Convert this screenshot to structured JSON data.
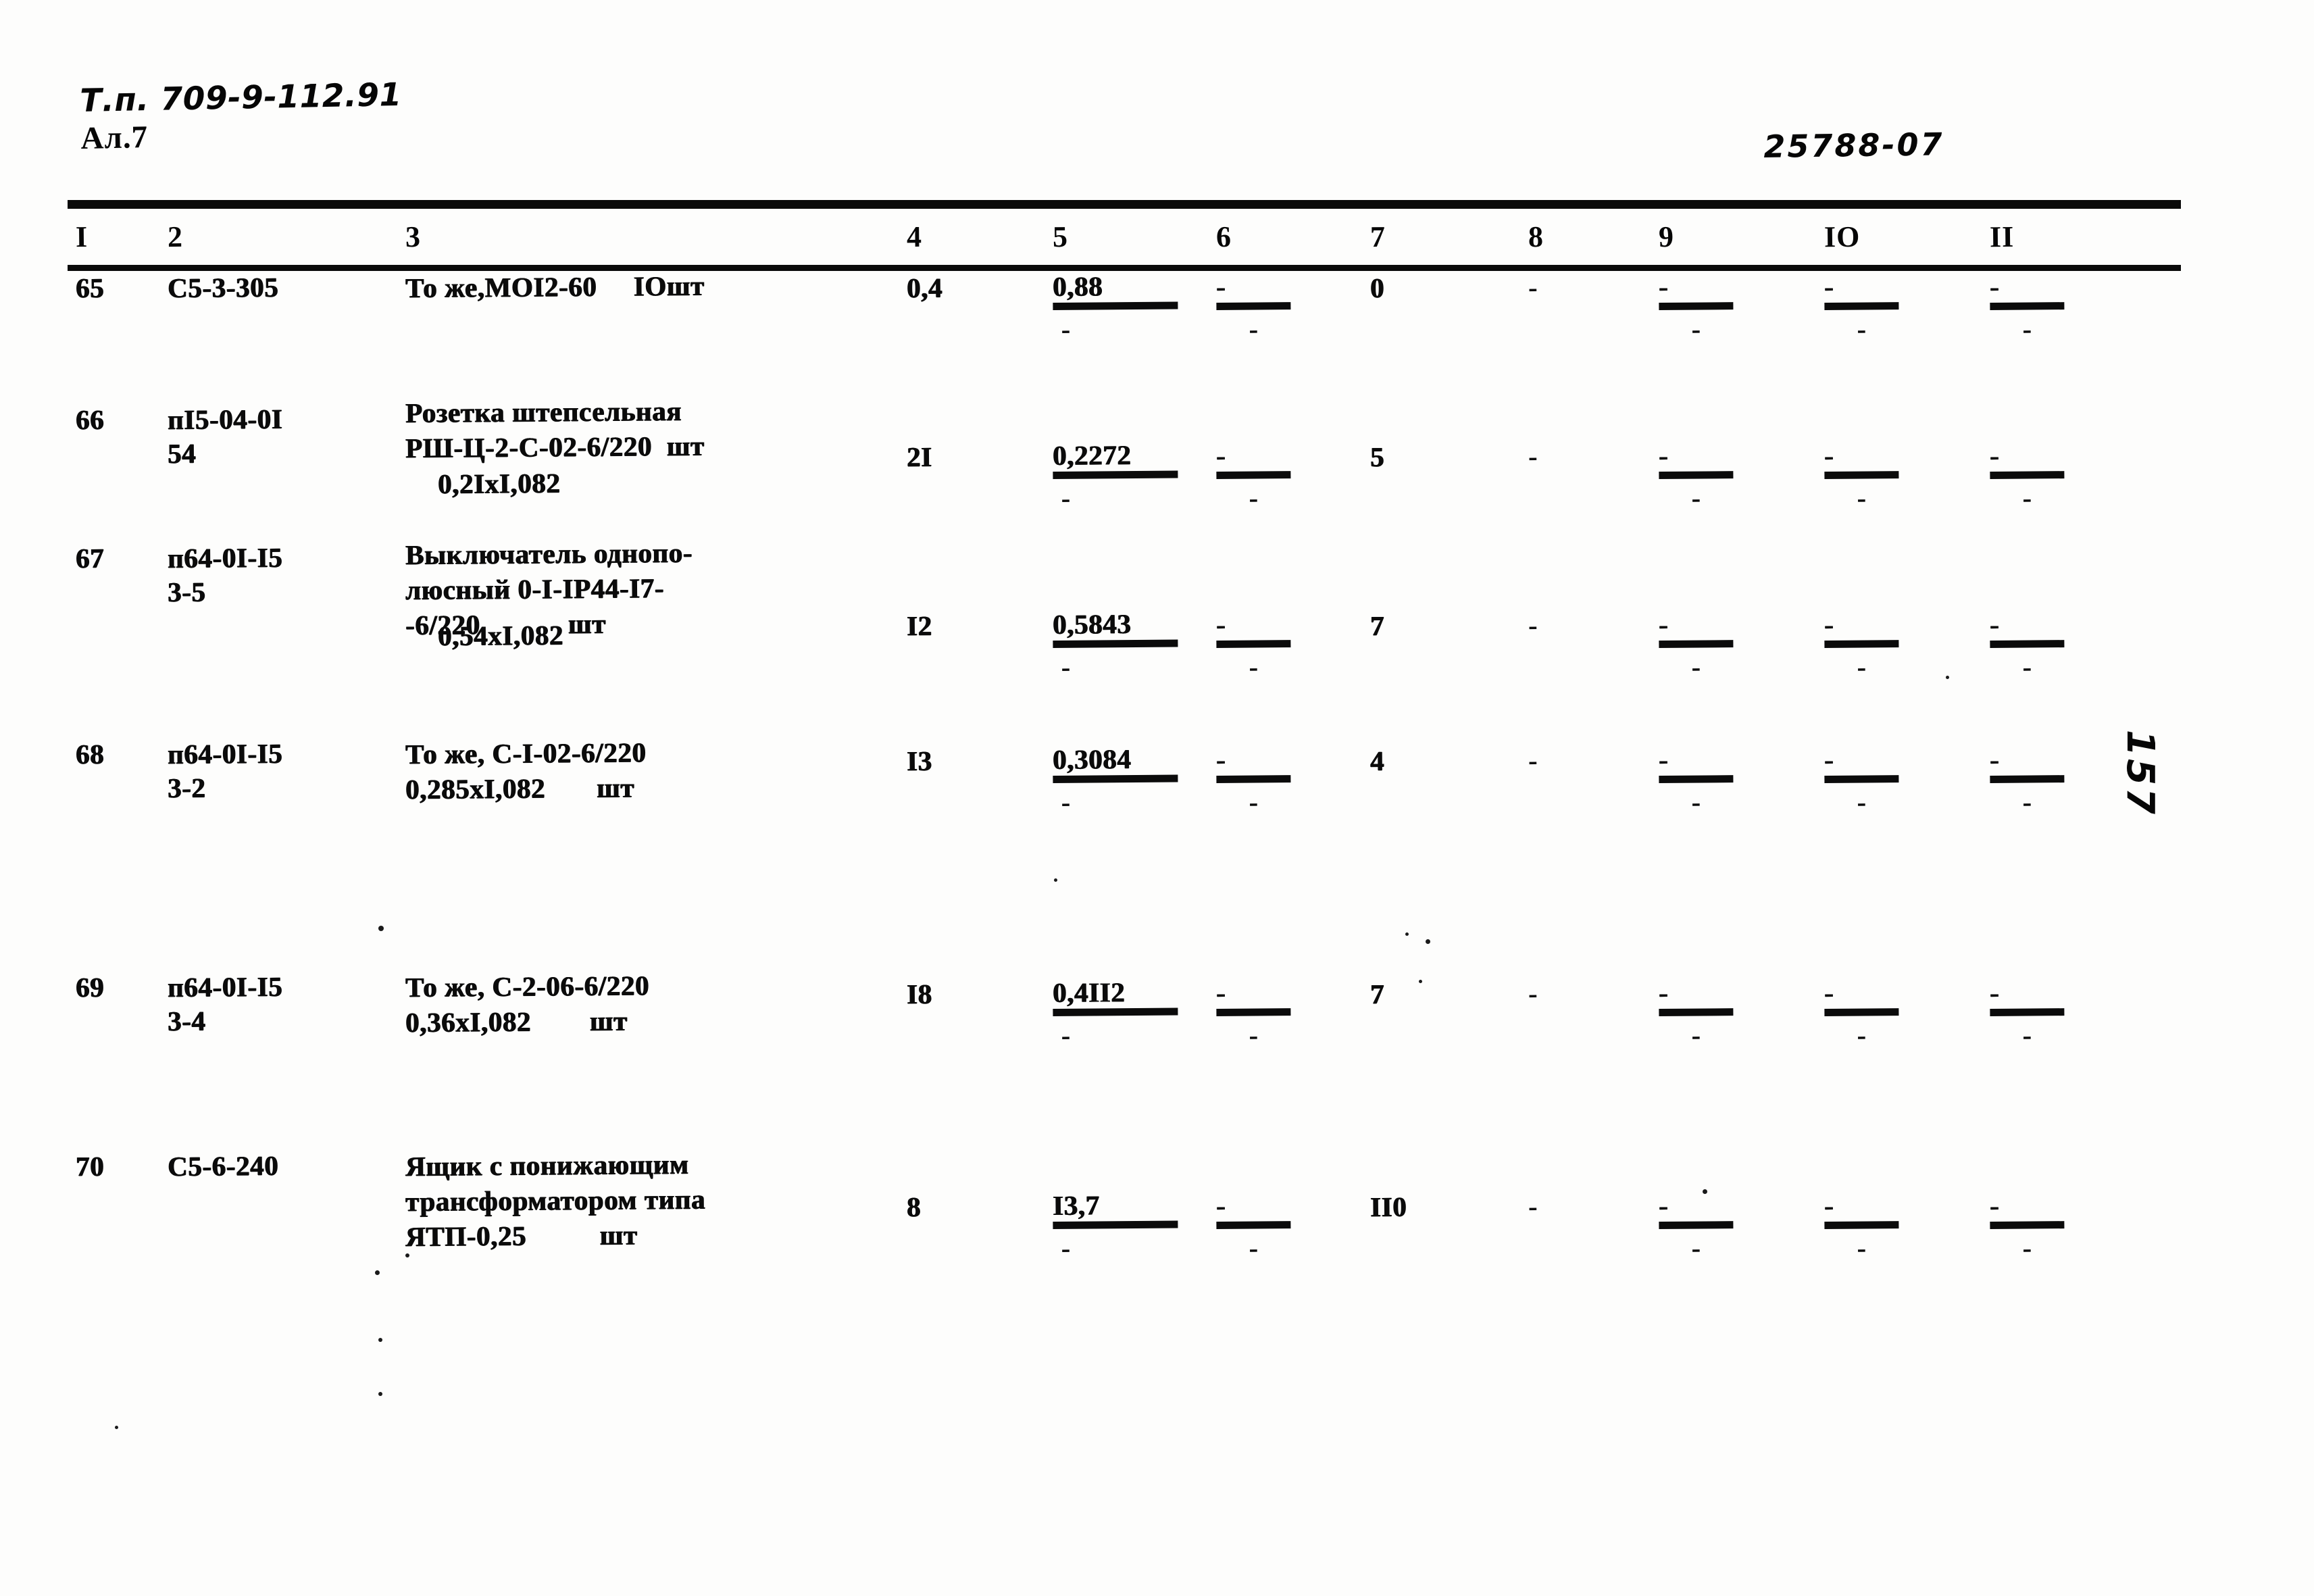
{
  "header": {
    "doc_code": "Т.п. 709-9-112.91",
    "album": "Ал.7",
    "album_ref": "25788-07"
  },
  "page_number": "157",
  "table": {
    "column_headers": [
      "I",
      "2",
      "3",
      "4",
      "5",
      "6",
      "7",
      "8",
      "9",
      "IO",
      "II"
    ],
    "rows": [
      {
        "num": "65",
        "code": "С5-3-305",
        "desc_line1": "То же,МОI2-60     IOшт",
        "desc_line2": "",
        "desc_line3": "",
        "sub_line": "",
        "col4": "0,4",
        "col5_top": "0,88",
        "col5_bot": "-",
        "col6_top": "-",
        "col6_bot": "-",
        "col7": "0",
        "col8": "-",
        "col9_top": "-",
        "col9_bot": "-",
        "col10_top": "-",
        "col10_bot": "-",
        "col11_top": "-",
        "col11_bot": "-"
      },
      {
        "num": "66",
        "code": "пI5-04-0I",
        "code_line2": "54",
        "desc_line1": "Розетка штепсельная",
        "desc_line2": "РШ-Ц-2-С-02-6/220  шт",
        "desc_line3": "",
        "sub_line": "0,2IxI,082",
        "col4": "2I",
        "col5_top": "0,2272",
        "col5_bot": "-",
        "col6_top": "-",
        "col6_bot": "-",
        "col7": "5",
        "col8": "-",
        "col9_top": "-",
        "col9_bot": "-",
        "col10_top": "-",
        "col10_bot": "-",
        "col11_top": "-",
        "col11_bot": "-"
      },
      {
        "num": "67",
        "code": "п64-0I-I5",
        "code_line2": "3-5",
        "desc_line1": "Выключатель однопо-",
        "desc_line2": "люсный 0-I-IР44-I7-",
        "desc_line3": "-6/220            шт",
        "sub_line": "0,54xI,082",
        "col4": "I2",
        "col5_top": "0,5843",
        "col5_bot": "-",
        "col6_top": "-",
        "col6_bot": "-",
        "col7": "7",
        "col8": "-",
        "col9_top": "-",
        "col9_bot": "-",
        "col10_top": "-",
        "col10_bot": "-",
        "col11_top": "-",
        "col11_bot": "-"
      },
      {
        "num": "68",
        "code": "п64-0I-I5",
        "code_line2": "3-2",
        "desc_line1": "То же, С-I-02-6/220",
        "desc_line2": "0,285xI,082       шт",
        "desc_line3": "",
        "sub_line": "",
        "col4": "I3",
        "col5_top": "0,3084",
        "col5_bot": "-",
        "col6_top": "-",
        "col6_bot": "-",
        "col7": "4",
        "col8": "-",
        "col9_top": "-",
        "col9_bot": "-",
        "col10_top": "-",
        "col10_bot": "-",
        "col11_top": "-",
        "col11_bot": "-"
      },
      {
        "num": "69",
        "code": "п64-0I-I5",
        "code_line2": "3-4",
        "desc_line1": "То же, С-2-06-6/220",
        "desc_line2": "0,36xI,082        шт",
        "desc_line3": "",
        "sub_line": "",
        "col4": "I8",
        "col5_top": "0,4II2",
        "col5_bot": "-",
        "col6_top": "-",
        "col6_bot": "-",
        "col7": "7",
        "col8": "-",
        "col9_top": "-",
        "col9_bot": "-",
        "col10_top": "-",
        "col10_bot": "-",
        "col11_top": "-",
        "col11_bot": "-"
      },
      {
        "num": "70",
        "code": "С5-6-240",
        "code_line2": "",
        "desc_line1": "Ящик с понижающим",
        "desc_line2": "трансформатором типа",
        "desc_line3": "ЯТП-0,25          шт",
        "sub_line": "",
        "col4": "8",
        "col5_top": "I3,7",
        "col5_bot": "-",
        "col6_top": "-",
        "col6_bot": "-",
        "col7": "II0",
        "col8": "-",
        "col9_top": "-",
        "col9_bot": "-",
        "col10_top": "-",
        "col10_bot": "-",
        "col11_top": "-",
        "col11_bot": "-"
      }
    ]
  }
}
